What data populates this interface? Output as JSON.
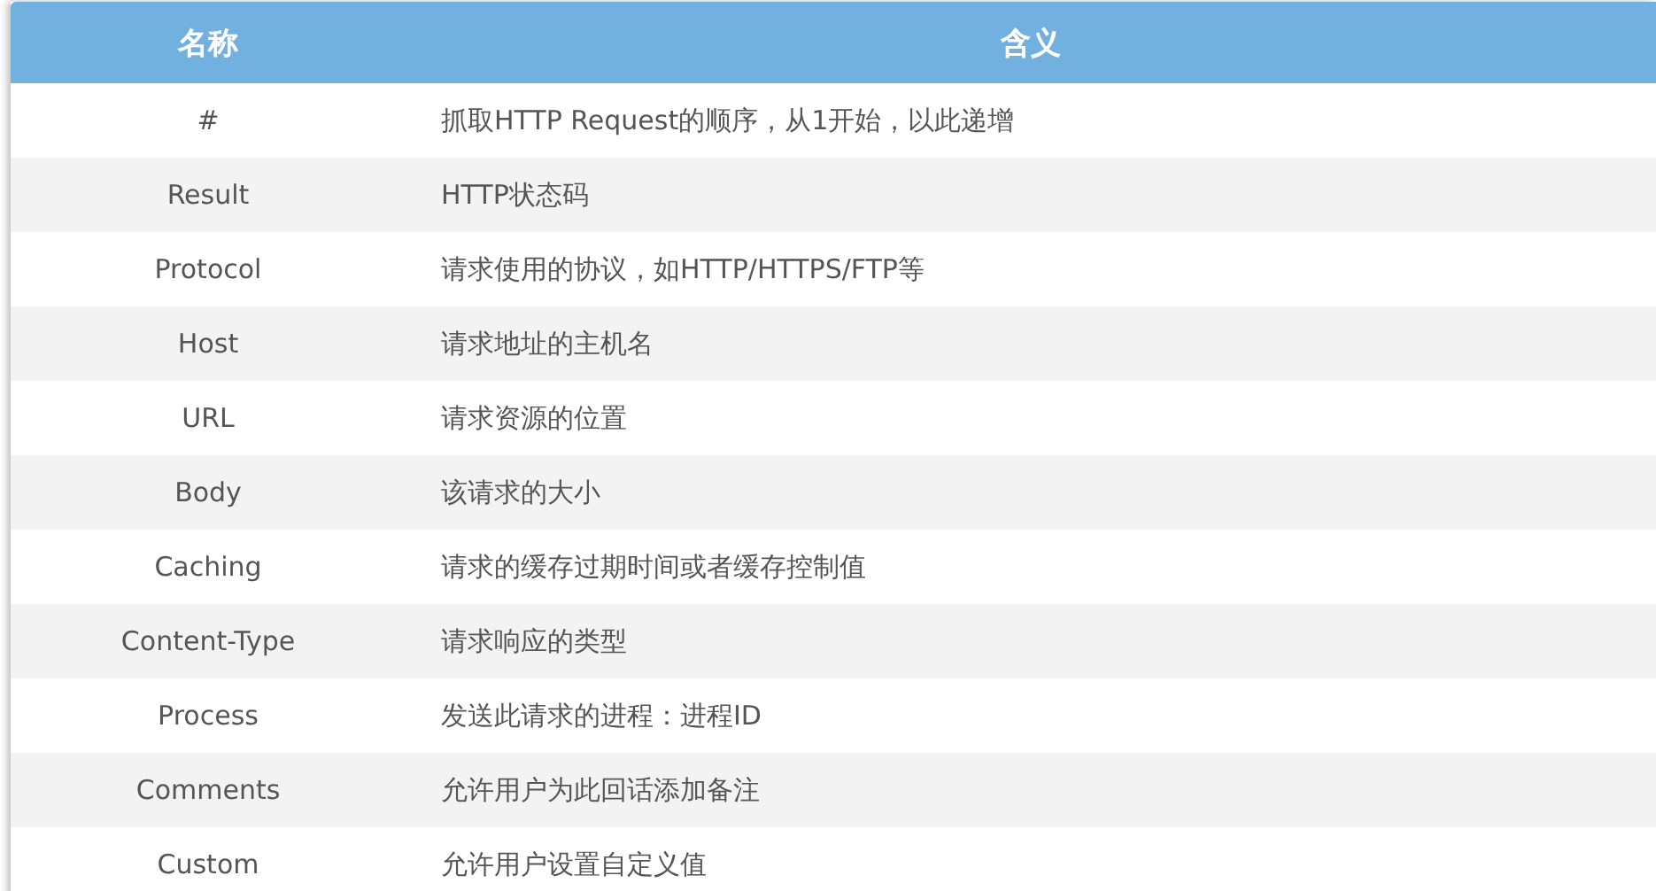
{
  "table": {
    "columns": [
      "名称",
      "含义"
    ],
    "rows": [
      [
        "#",
        "抓取HTTP Request的顺序，从1开始，以此递增"
      ],
      [
        "Result",
        "HTTP状态码"
      ],
      [
        "Protocol",
        "请求使用的协议，如HTTP/HTTPS/FTP等"
      ],
      [
        "Host",
        "请求地址的主机名"
      ],
      [
        "URL",
        "请求资源的位置"
      ],
      [
        "Body",
        "该请求的大小"
      ],
      [
        "Caching",
        "请求的缓存过期时间或者缓存控制值"
      ],
      [
        "Content-Type",
        "请求响应的类型"
      ],
      [
        "Process",
        "发送此请求的进程：进程ID"
      ],
      [
        "Comments",
        "允许用户为此回话添加备注"
      ],
      [
        "Custom",
        "允许用户设置自定义值"
      ]
    ]
  }
}
